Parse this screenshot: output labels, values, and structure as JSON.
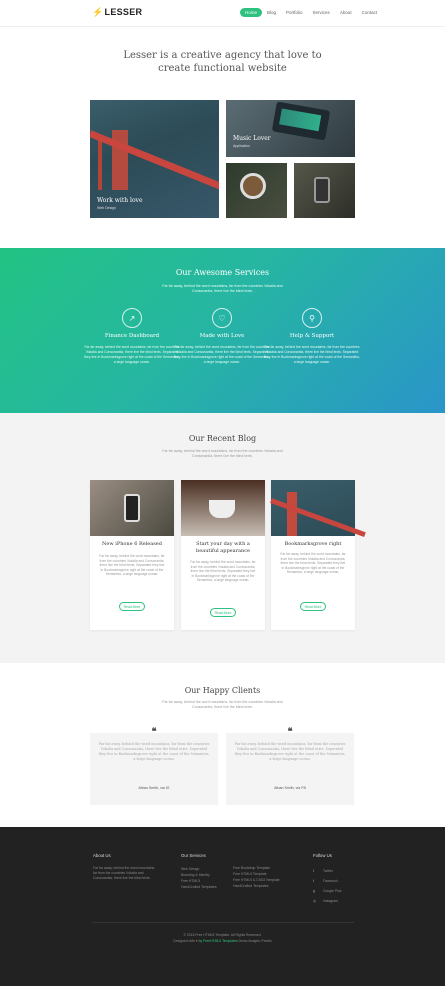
{
  "header": {
    "logo": "LESSER",
    "menu": [
      "Home",
      "Blog",
      "Portfolio",
      "Services",
      "About",
      "Contact"
    ]
  },
  "hero": {
    "title_line1": "Lesser is a creative agency that love to",
    "title_line2": "create functional website"
  },
  "portfolio": {
    "tiles": [
      {
        "title": "Work with love",
        "subtitle": "Web Design"
      },
      {
        "title": "Music Lover",
        "subtitle": "Application"
      },
      {
        "title": "",
        "subtitle": ""
      },
      {
        "title": "",
        "subtitle": ""
      }
    ]
  },
  "services": {
    "title": "Our Awesome Services",
    "intro": "Far far away, behind the word mountains, far from the countries Vokalia and Consonantia, there live the blind texts.",
    "items": [
      {
        "icon": "chart-icon",
        "glyph": "↗",
        "title": "Finance Dashboard",
        "desc": "Far far away, behind the word mountains, far from the countries Vokalia and Consonantia, there live the blind texts. Separated they live in Bookmarksgrove right at the coast of the Semantics, a large language ocean."
      },
      {
        "icon": "heart-icon",
        "glyph": "♡",
        "title": "Made with Love",
        "desc": "Far far away, behind the word mountains, far from the countries Vokalia and Consonantia, there live the blind texts. Separated they live in Bookmarksgrove right at the coast of the Semantics, a large language ocean."
      },
      {
        "icon": "search-icon",
        "glyph": "⚲",
        "title": "Help & Support",
        "desc": "Far far away, behind the word mountains, far from the countries Vokalia and Consonantia, there live the blind texts. Separated they live in Bookmarksgrove right at the coast of the Semantics, a large language ocean."
      }
    ]
  },
  "blog": {
    "title": "Our Recent Blog",
    "intro": "Far far away, behind the word mountains, far from the countries Vokalia and Consonantia, there live the blind texts.",
    "posts": [
      {
        "title": "New iPhone 6 Released",
        "desc": "Far far away, behind the word mountains, far from the countries Vokalia and Consonantia, there live the blind texts. Separated they live in Bookmarksgrove right at the coast of the Semantics, a large language ocean.",
        "button": "Read More"
      },
      {
        "title": "Start your day with a beautiful appearance",
        "desc": "Far far away, behind the word mountains, far from the countries Vokalia and Consonantia, there live the blind texts. Separated they live in Bookmarksgrove right at the coast of the Semantics, a large language ocean.",
        "button": "Read More"
      },
      {
        "title": "Bookmarksgrove right",
        "desc": "Far far away, behind the word mountains, far from the countries Vokalia and Consonantia, there live the blind texts. Separated they live in Bookmarksgrove right at the coast of the Semantics, a large language ocean.",
        "button": "Read More"
      }
    ]
  },
  "clients": {
    "title": "Our Happy Clients",
    "intro": "Far far away, behind the word mountains, far from the countries Vokalia and Consonantia, there live the blind texts.",
    "quotes": [
      {
        "text": "Far far away, behind the word mountains, far from the countries Vokalia and Consonantia, there live the blind texts. Separated they live in Bookmarksgrove right at the coast of the Semantics, a large language ocean.",
        "author": "Athan Smith, via IG"
      },
      {
        "text": "Far far away, behind the word mountains, far from the countries Vokalia and Consonantia, there live the blind texts. Separated they live in Bookmarksgrove right at the coast of the Semantics, a large language ocean.",
        "author": "Athan Smith, via FB"
      }
    ]
  },
  "footer": {
    "about_head": "About Us",
    "about_text": "Far far away, behind the word mountains, far from the countries Vokalia and Consonantia, there live the blind texts.",
    "services_head": "Our Services",
    "services_col1": [
      "Web Design",
      "Branding & Identity",
      "Free HTML5",
      "HandCrafted Templates"
    ],
    "services_col2": [
      "Free Bootstrap Template",
      "Free HTML5 Template",
      "Free HTML5 & CSS3 Template",
      "HandCrafted Templates"
    ],
    "follow_head": "Follow Us",
    "social": [
      {
        "icon": "twitter-icon",
        "glyph": "t",
        "label": "Twitter"
      },
      {
        "icon": "facebook-icon",
        "glyph": "f",
        "label": "Facebook"
      },
      {
        "icon": "googleplus-icon",
        "glyph": "g",
        "label": "Google Plus"
      },
      {
        "icon": "instagram-icon",
        "glyph": "◎",
        "label": "Instagram"
      }
    ],
    "copyright_line1": "© 2016 Free HTML5 Template. All Rights Reserved.",
    "copyright_line2_prefix": "Designed with",
    "copyright_line2_mid": "by FreeHTML5 Templates",
    "copyright_line2_suffix": "Demo Images: Pexels"
  },
  "colors": {
    "accent": "#2ec17f",
    "gradient_start": "#22c383",
    "gradient_end": "#2a95c9",
    "footer_bg": "#222222"
  }
}
